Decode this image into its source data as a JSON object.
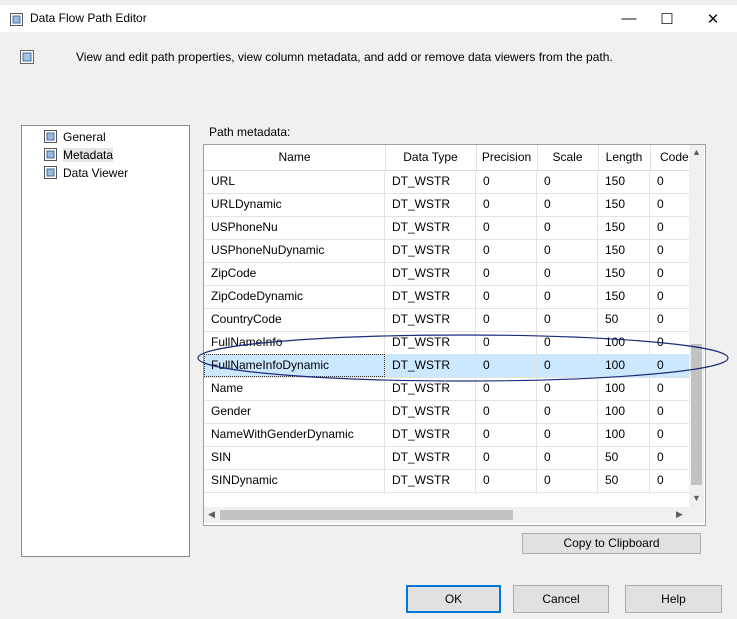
{
  "window": {
    "title": "Data Flow Path Editor",
    "minimize_glyph": "—",
    "maximize_glyph": "☐",
    "close_glyph": "✕"
  },
  "header": {
    "description": "View and edit path properties, view column metadata, and add or remove data viewers from the path."
  },
  "tree": {
    "items": [
      {
        "label": "General",
        "icon": "properties-icon",
        "selected": false
      },
      {
        "label": "Metadata",
        "icon": "metadata-icon",
        "selected": true
      },
      {
        "label": "Data Viewer",
        "icon": "data-viewer-icon",
        "selected": false
      }
    ]
  },
  "grid": {
    "label": "Path metadata:",
    "columns": [
      "Name",
      "Data Type",
      "Precision",
      "Scale",
      "Length",
      "Code P"
    ],
    "rows": [
      [
        "URL",
        "DT_WSTR",
        "0",
        "0",
        "150",
        "0"
      ],
      [
        "URLDynamic",
        "DT_WSTR",
        "0",
        "0",
        "150",
        "0"
      ],
      [
        "USPhoneNu",
        "DT_WSTR",
        "0",
        "0",
        "150",
        "0"
      ],
      [
        "USPhoneNuDynamic",
        "DT_WSTR",
        "0",
        "0",
        "150",
        "0"
      ],
      [
        "ZipCode",
        "DT_WSTR",
        "0",
        "0",
        "150",
        "0"
      ],
      [
        "ZipCodeDynamic",
        "DT_WSTR",
        "0",
        "0",
        "150",
        "0"
      ],
      [
        "CountryCode",
        "DT_WSTR",
        "0",
        "0",
        "50",
        "0"
      ],
      [
        "FullNameInfo",
        "DT_WSTR",
        "0",
        "0",
        "100",
        "0"
      ],
      [
        "FullNameInfoDynamic",
        "DT_WSTR",
        "0",
        "0",
        "100",
        "0"
      ],
      [
        "Name",
        "DT_WSTR",
        "0",
        "0",
        "100",
        "0"
      ],
      [
        "Gender",
        "DT_WSTR",
        "0",
        "0",
        "100",
        "0"
      ],
      [
        "NameWithGenderDynamic",
        "DT_WSTR",
        "0",
        "0",
        "100",
        "0"
      ],
      [
        "SIN",
        "DT_WSTR",
        "0",
        "0",
        "50",
        "0"
      ],
      [
        "SINDynamic",
        "DT_WSTR",
        "0",
        "0",
        "50",
        "0"
      ]
    ],
    "selected_row_index": 8,
    "highlight_color": "#cce8ff",
    "annotation_color": "#1e2a7a"
  },
  "buttons": {
    "copy": "Copy to Clipboard",
    "ok": "OK",
    "cancel": "Cancel",
    "help": "Help"
  }
}
